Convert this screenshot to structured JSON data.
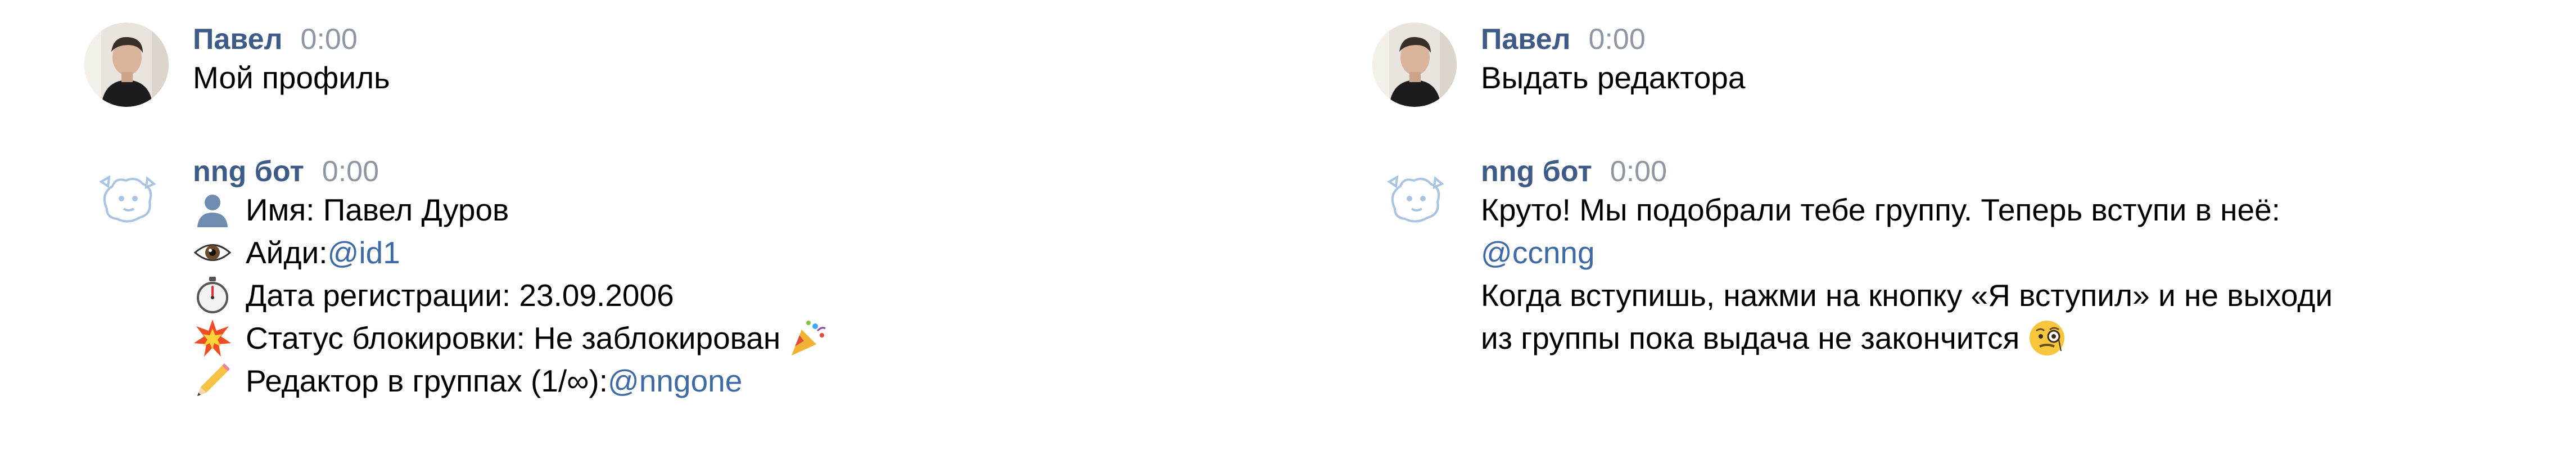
{
  "left": {
    "user_message": {
      "author": "Павел",
      "time": "0:00",
      "text": "Мой профиль"
    },
    "bot_message": {
      "author": "nng бот",
      "time": "0:00",
      "lines": [
        {
          "icon": "bust-silhouette-icon",
          "label": "Имя: Павел Дуров",
          "link": ""
        },
        {
          "icon": "eye-icon",
          "label": "Айди: ",
          "link": "@id1"
        },
        {
          "icon": "stopwatch-icon",
          "label": "Дата регистрации: 23.09.2006",
          "link": ""
        },
        {
          "icon": "collision-icon",
          "label": "Статус блокировки: Не заблокирован",
          "link": "",
          "trailing_icon": "party-popper-icon"
        },
        {
          "icon": "pencil-icon",
          "label": "Редактор в группах (1/∞): ",
          "link": "@nngone"
        }
      ]
    }
  },
  "right": {
    "user_message": {
      "author": "Павел",
      "time": "0:00",
      "text": "Выдать редактора"
    },
    "bot_message": {
      "author": "nng бот",
      "time": "0:00",
      "line1": "Круто! Мы подобрали тебе группу. Теперь вступи в неё:",
      "link": "@ccnng",
      "line3": "Когда вступишь, нажми на кнопку «Я вступил» и не выходи",
      "line4": "из группы пока выдача не закончится",
      "trailing_icon": "face-with-monocle-icon"
    }
  },
  "colors": {
    "author": "#3e5a86",
    "time": "#8d96a3",
    "link": "#3e6aa5",
    "text": "#000000"
  }
}
